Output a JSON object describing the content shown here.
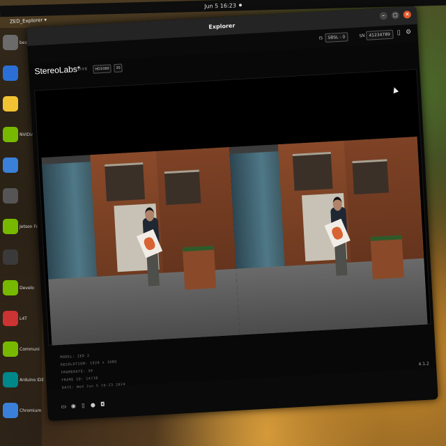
{
  "topbar": {
    "clock": "Jun 5 16:23"
  },
  "app_menu": "ZED_Explorer ▾",
  "dock": {
    "items": [
      {
        "label": "bestbuy",
        "color": "#6b6b6b"
      },
      {
        "label": "",
        "color": "#2b6fd6"
      },
      {
        "label": "",
        "color": "#f1c232"
      },
      {
        "label": "NVIDIA Jetson",
        "color": "#76b900"
      },
      {
        "label": "",
        "color": "#3a80d8"
      },
      {
        "label": "",
        "color": "#555555"
      },
      {
        "label": "Jetson Forum",
        "color": "#76b900"
      },
      {
        "label": "",
        "color": "#3a3a3a"
      },
      {
        "label": "Develo",
        "color": "#76b900"
      },
      {
        "label": "L4T",
        "color": "#cc3333"
      },
      {
        "label": "Communi",
        "color": "#76b900"
      },
      {
        "label": "Arduino IDE",
        "color": "#00878a"
      },
      {
        "label": "Chromium",
        "color": "#3a80d8"
      }
    ]
  },
  "window": {
    "title": "Explorer",
    "controls": {
      "minimize": "–",
      "maximize": "□",
      "close": "×"
    }
  },
  "toolbar": {
    "lbl_one": "IS",
    "select_one": "SBSL - 0",
    "lbl_two": "SN",
    "select_two": "41234789"
  },
  "brand": {
    "name": "StereoLabs*",
    "live": "LIVE",
    "res_select": "HD1080",
    "fps_select": "30"
  },
  "info_lines": [
    "MODEL: ZED 2",
    "RESOLUTION: 1920 x 1080",
    "FRAMERATE: 30",
    "FRAME ID: 14738",
    "DATE: Wed Jun 5 16:23 2024"
  ],
  "version": "4.1.2",
  "colors": {
    "accent": "#e05a2a",
    "window_bg": "#080808"
  }
}
